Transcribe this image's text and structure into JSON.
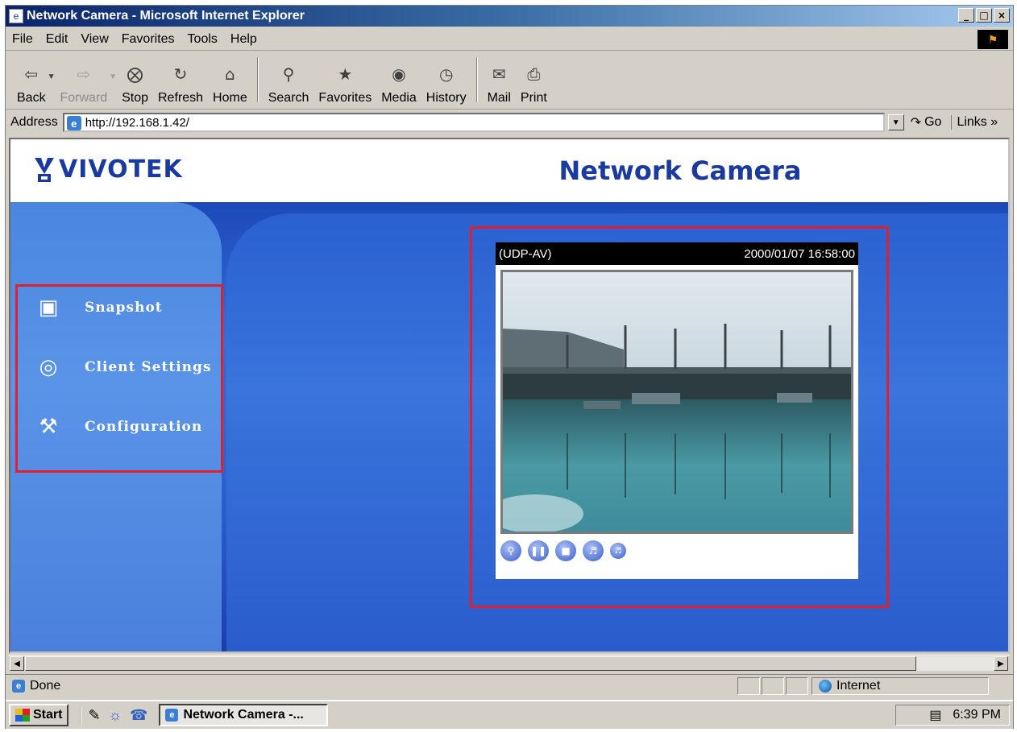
{
  "window": {
    "title": "Network Camera - Microsoft Internet Explorer",
    "controls": [
      "_",
      "□",
      "×"
    ]
  },
  "menu": {
    "items": [
      "File",
      "Edit",
      "View",
      "Favorites",
      "Tools",
      "Help"
    ]
  },
  "toolbar": {
    "back": "Back",
    "forward": "Forward",
    "stop": "Stop",
    "refresh": "Refresh",
    "home": "Home",
    "search": "Search",
    "favorites": "Favorites",
    "media": "Media",
    "history": "History",
    "mail": "Mail",
    "print": "Print"
  },
  "address": {
    "label": "Address",
    "url": "http://192.168.1.42/",
    "go": "Go",
    "links": "Links »"
  },
  "page": {
    "logo_text": "VIVOTEK",
    "title": "Network Camera"
  },
  "nav": {
    "snapshot": "Snapshot",
    "client_settings": "Client Settings",
    "configuration": "Configuration"
  },
  "video": {
    "protocol": "(UDP-AV)",
    "timestamp": "2000/01/07 16:58:00"
  },
  "status": {
    "text": "Done",
    "zone": "Internet"
  },
  "taskbar": {
    "start": "Start",
    "task": "Network Camera -...",
    "clock": "6:39 PM"
  },
  "colors": {
    "highlight_border": "#e0202a",
    "brand_blue": "#1a3aa0",
    "page_blue": "#2454c0"
  }
}
